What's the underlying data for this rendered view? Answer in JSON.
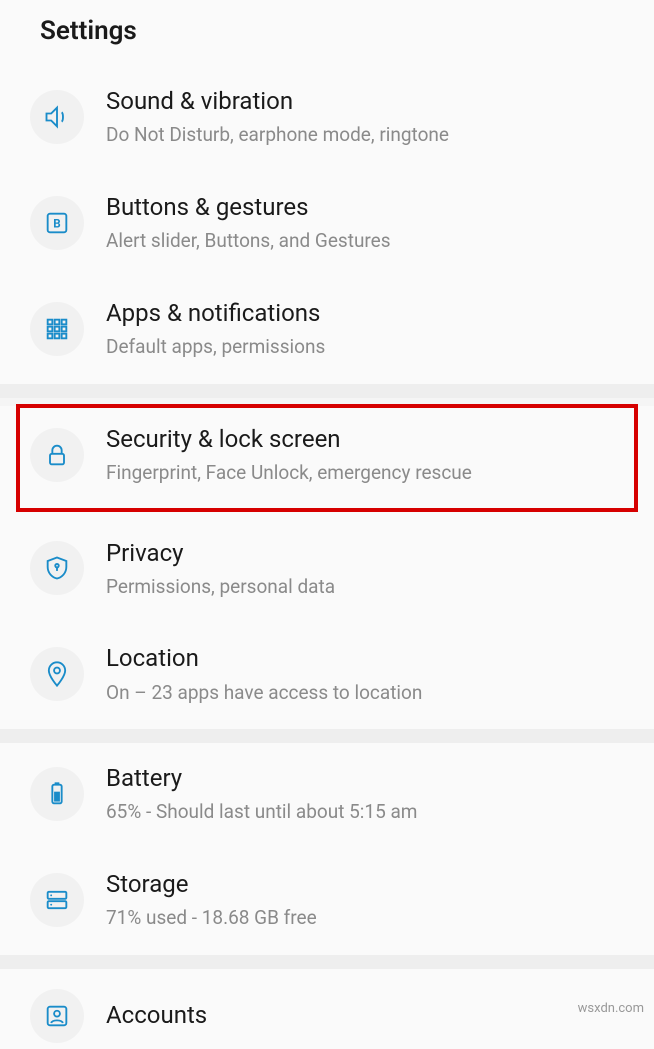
{
  "header": {
    "title": "Settings"
  },
  "sections": [
    {
      "items": [
        {
          "icon": "speaker-icon",
          "title": "Sound & vibration",
          "subtitle": "Do Not Disturb, earphone mode, ringtone"
        },
        {
          "icon": "button-icon",
          "title": "Buttons & gestures",
          "subtitle": "Alert slider, Buttons, and Gestures"
        },
        {
          "icon": "grid-icon",
          "title": "Apps & notifications",
          "subtitle": "Default apps, permissions"
        }
      ]
    },
    {
      "items": [
        {
          "icon": "lock-icon",
          "title": "Security & lock screen",
          "subtitle": "Fingerprint, Face Unlock, emergency rescue",
          "highlighted": true
        },
        {
          "icon": "shield-icon",
          "title": "Privacy",
          "subtitle": "Permissions, personal data"
        },
        {
          "icon": "pin-icon",
          "title": "Location",
          "subtitle": "On – 23 apps have access to location"
        }
      ]
    },
    {
      "items": [
        {
          "icon": "battery-icon",
          "title": "Battery",
          "subtitle": "65% - Should last until about 5:15 am"
        },
        {
          "icon": "storage-icon",
          "title": "Storage",
          "subtitle": "71% used - 18.68 GB free"
        }
      ]
    },
    {
      "items": [
        {
          "icon": "accounts-icon",
          "title": "Accounts",
          "subtitle": ""
        }
      ]
    }
  ],
  "watermark": "wsxdn.com"
}
